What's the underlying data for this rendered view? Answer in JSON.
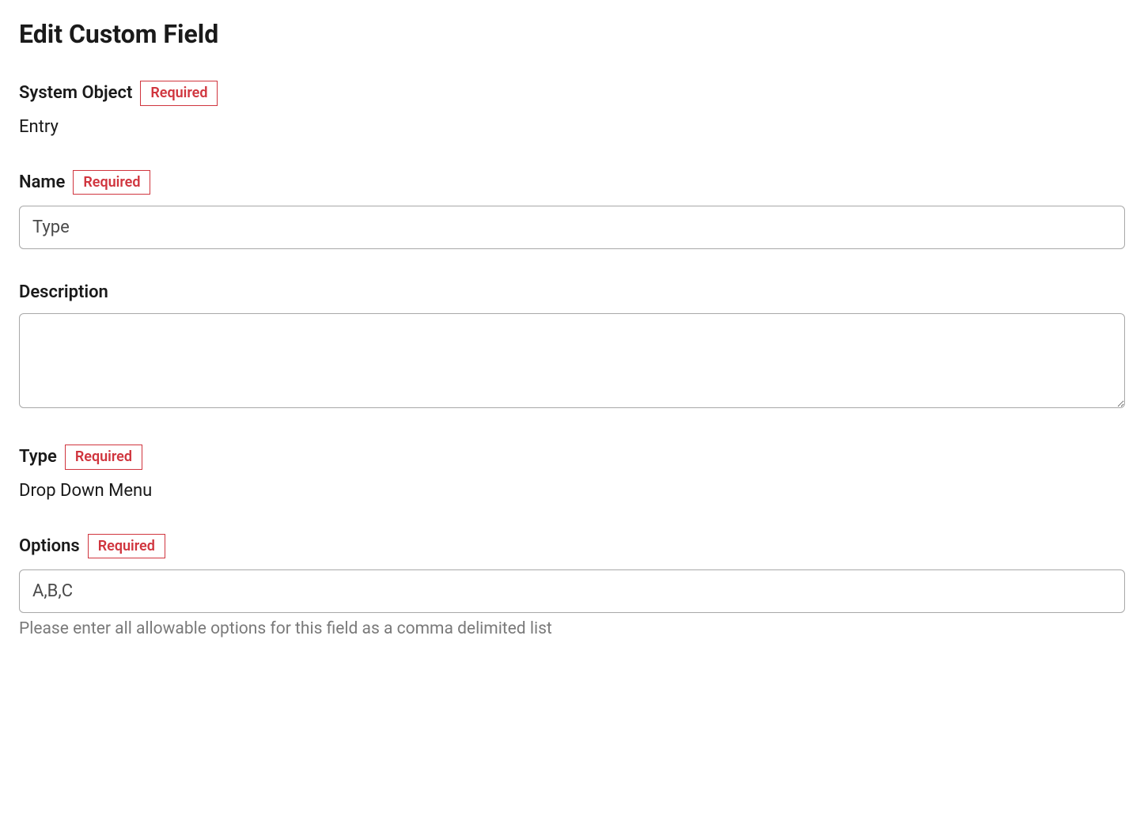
{
  "pageTitle": "Edit Custom Field",
  "requiredLabel": "Required",
  "fields": {
    "systemObject": {
      "label": "System Object",
      "value": "Entry",
      "required": true
    },
    "name": {
      "label": "Name",
      "value": "Type",
      "required": true
    },
    "description": {
      "label": "Description",
      "value": "",
      "required": false
    },
    "type": {
      "label": "Type",
      "value": "Drop Down Menu",
      "required": true
    },
    "options": {
      "label": "Options",
      "value": "A,B,C",
      "required": true,
      "helpText": "Please enter all allowable options for this field as a comma delimited list"
    }
  }
}
